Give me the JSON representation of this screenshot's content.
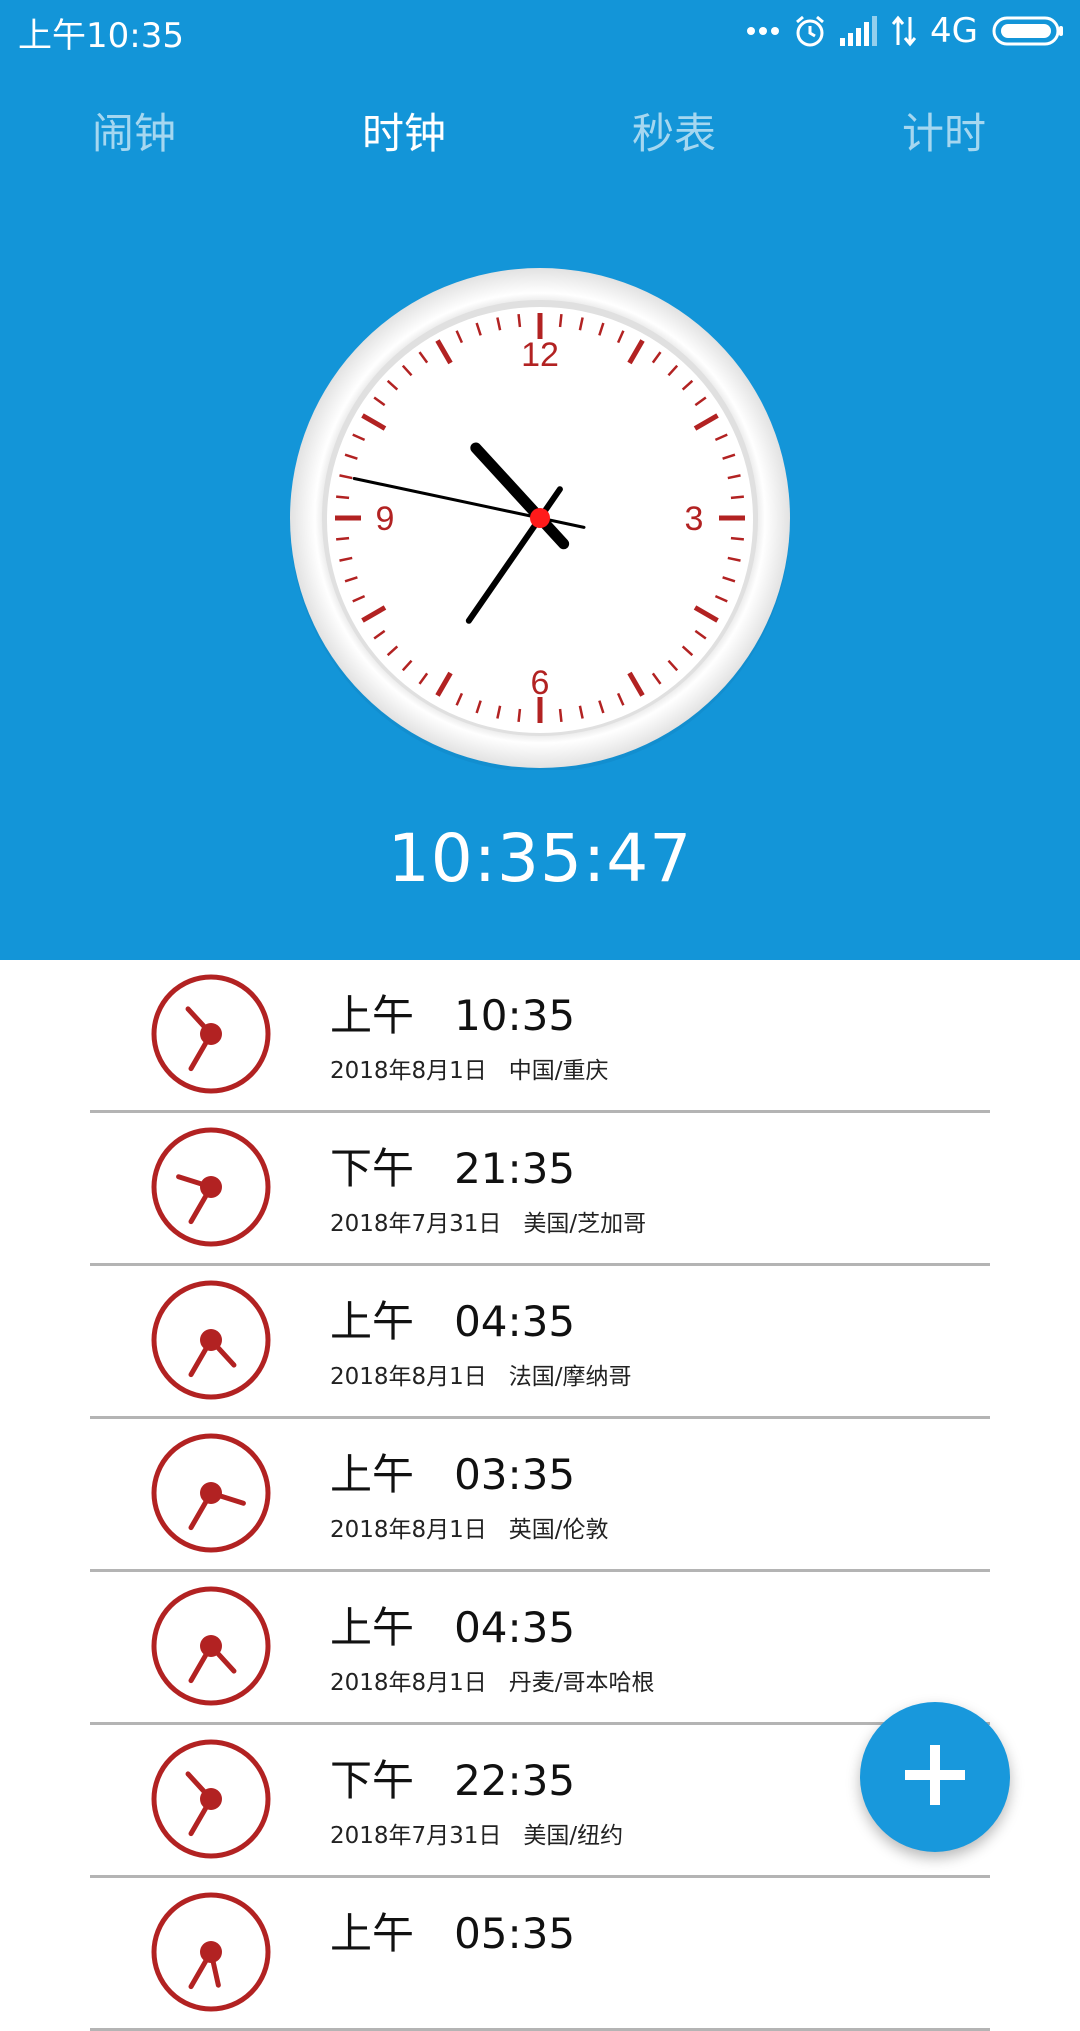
{
  "status_bar": {
    "time": "上午10:35",
    "network": "4G",
    "icons": [
      "more-dots-icon",
      "alarm-icon",
      "signal-icon",
      "data-arrows-icon",
      "battery-icon"
    ]
  },
  "tabs": [
    {
      "label": "闹钟",
      "active": false
    },
    {
      "label": "时钟",
      "active": true
    },
    {
      "label": "秒表",
      "active": false
    },
    {
      "label": "计时",
      "active": false
    }
  ],
  "main_clock": {
    "digital_time": "10:35:47",
    "dial_numbers": [
      "12",
      "3",
      "6",
      "9"
    ],
    "hour": 10,
    "minute": 35,
    "second": 47
  },
  "world_clocks": [
    {
      "period": "上午",
      "time": "10:35",
      "date": "2018年8月1日",
      "city": "中国/重庆",
      "hour": 10,
      "minute": 35
    },
    {
      "period": "下午",
      "time": "21:35",
      "date": "2018年7月31日",
      "city": "美国/芝加哥",
      "hour": 21,
      "minute": 35
    },
    {
      "period": "上午",
      "time": "04:35",
      "date": "2018年8月1日",
      "city": "法国/摩纳哥",
      "hour": 4,
      "minute": 35
    },
    {
      "period": "上午",
      "time": "03:35",
      "date": "2018年8月1日",
      "city": "英国/伦敦",
      "hour": 3,
      "minute": 35
    },
    {
      "period": "上午",
      "time": "04:35",
      "date": "2018年8月1日",
      "city": "丹麦/哥本哈根",
      "hour": 4,
      "minute": 35
    },
    {
      "period": "下午",
      "time": "22:35",
      "date": "2018年7月31日",
      "city": "美国/纽约",
      "hour": 22,
      "minute": 35
    },
    {
      "period": "上午",
      "time": "05:35",
      "date": "",
      "city": "",
      "hour": 5,
      "minute": 35
    }
  ],
  "fab": {
    "icon": "plus-icon"
  },
  "colors": {
    "header_bg": "#1395d8",
    "accent_red": "#b22222",
    "fab_bg": "#1898dc",
    "divider": "#b4b4b4"
  }
}
